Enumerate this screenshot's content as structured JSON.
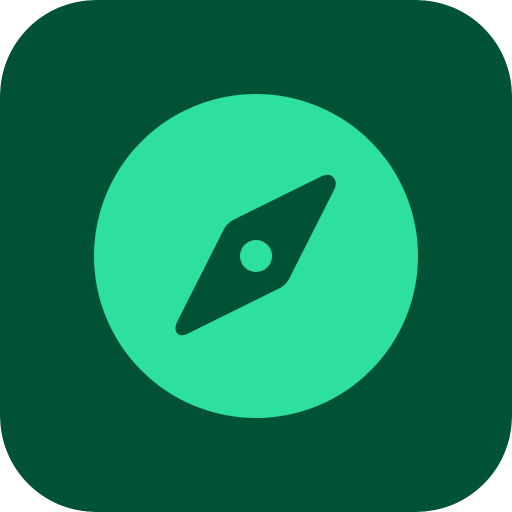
{
  "app_icon": {
    "icon_name": "compass-icon",
    "colors": {
      "tile_background": "#005237",
      "disc": "#2EE09D",
      "needle": "#005237",
      "hub": "#2EE09D"
    }
  }
}
